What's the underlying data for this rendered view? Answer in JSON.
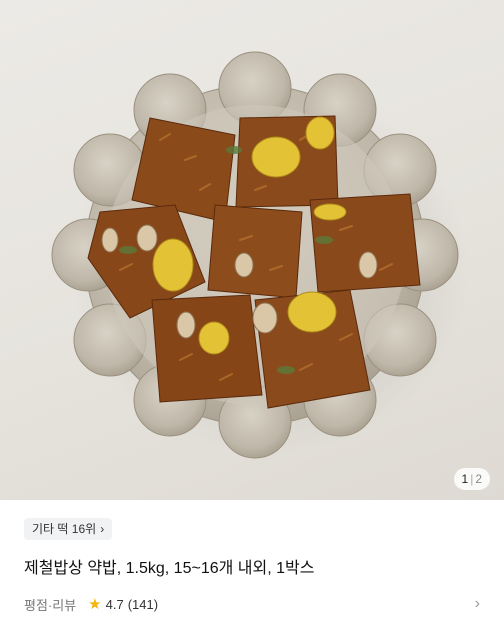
{
  "gallery": {
    "current_page": "1",
    "separator": "|",
    "total_pages": "2",
    "image_alt": "약밥 product photo"
  },
  "product": {
    "rank_chip": "기타 떡 16위",
    "title": "제철밥상 약밥, 1.5kg, 15~16개 내외, 1박스",
    "rating_label": "평점·리뷰",
    "rating_score": "4.7",
    "review_count": "(141)"
  },
  "icons": {
    "rank_chevron": "chevron-right-icon",
    "star": "star-icon",
    "rating_chevron": "chevron-right-icon"
  },
  "colors": {
    "star": "#f5b50a",
    "chip_bg": "#f1f2f4"
  }
}
